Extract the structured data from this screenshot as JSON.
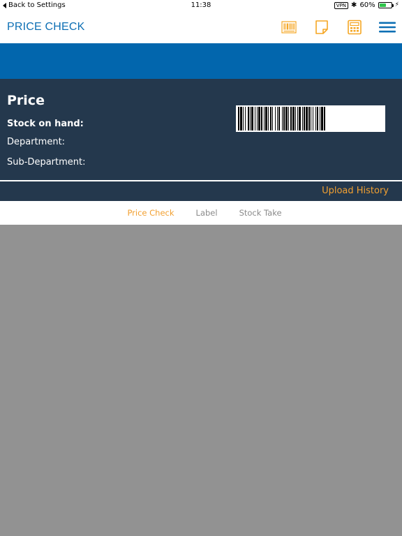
{
  "status_bar": {
    "back_label": "Back to Settings",
    "time": "11:38",
    "vpn": "VPN",
    "battery": "60%",
    "battery_level": 0.6
  },
  "nav": {
    "title": "PRICE CHECK",
    "icons": [
      "barcode-icon",
      "note-icon",
      "calculator-icon",
      "menu-icon"
    ]
  },
  "product": {
    "price_label": "Price",
    "stock_label": "Stock on hand:",
    "department_label": "Department:",
    "sub_department_label": "Sub-Department:"
  },
  "upload_history": "Upload History",
  "tabs": [
    {
      "label": "Price Check",
      "active": true
    },
    {
      "label": "Label",
      "active": false
    },
    {
      "label": "Stock Take",
      "active": false
    }
  ],
  "colors": {
    "brand_blue": "#0266ad",
    "title_blue": "#0d6fb4",
    "panel_dark": "#24384d",
    "accent_orange": "#f2a031",
    "icon_orange": "#f5a623",
    "background_gray": "#929292"
  }
}
